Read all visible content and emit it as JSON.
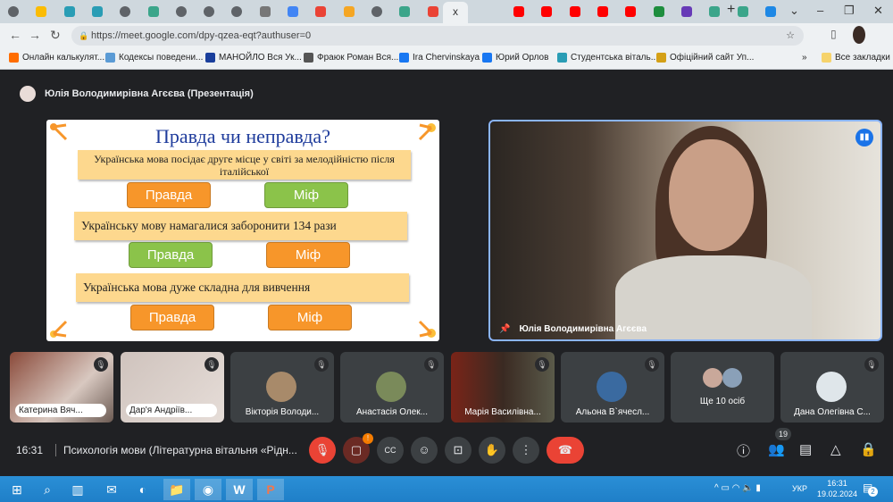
{
  "browser": {
    "tabs": [
      {
        "icon": "globe",
        "color": "#5f6368"
      },
      {
        "icon": "google-drive",
        "color": "#fbbc04"
      },
      {
        "icon": "shield",
        "color": "#2a9db5"
      },
      {
        "icon": "shield",
        "color": "#2a9db5"
      },
      {
        "icon": "globe",
        "color": "#5f6368"
      },
      {
        "icon": "app",
        "color": "#3ba58a"
      },
      {
        "icon": "globe",
        "color": "#5f6368"
      },
      {
        "icon": "globe",
        "color": "#5f6368"
      },
      {
        "icon": "globe",
        "color": "#5f6368"
      },
      {
        "icon": "doc",
        "color": "#777"
      },
      {
        "icon": "google-translate",
        "color": "#4285f4"
      },
      {
        "icon": "google",
        "color": "#ea4335"
      },
      {
        "icon": "warning",
        "color": "#f5a623"
      },
      {
        "icon": "globe",
        "color": "#5f6368"
      },
      {
        "icon": "app",
        "color": "#3ba58a"
      },
      {
        "icon": "gmail",
        "color": "#ea4335"
      },
      {
        "icon": "calendar",
        "color": "#4285f4"
      },
      {
        "icon": "youtube",
        "color": "#ff0000"
      },
      {
        "icon": "youtube",
        "color": "#ff0000"
      },
      {
        "icon": "youtube",
        "color": "#ff0000"
      },
      {
        "icon": "youtube",
        "color": "#ff0000"
      },
      {
        "icon": "youtube",
        "color": "#ff0000"
      },
      {
        "icon": "sheet",
        "color": "#1e8e3e"
      },
      {
        "icon": "forms",
        "color": "#673ab7"
      },
      {
        "icon": "app",
        "color": "#3ba58a"
      },
      {
        "icon": "app",
        "color": "#3ba58a"
      },
      {
        "icon": "p",
        "color": "#1e88e5"
      }
    ],
    "active_tab_close": "x",
    "new_tab": "+",
    "url": "https://meet.google.com/dpy-qzea-eqt?authuser=0",
    "bookmarks": [
      {
        "label": "Онлайн калькулят...",
        "color": "#ff6d00"
      },
      {
        "label": "Кодексы поведени...",
        "color": "#5b9bd5"
      },
      {
        "label": "МАНОЙЛО Вся Ук...",
        "color": "#1a3f9c"
      },
      {
        "label": "Фраюк Роман Вся...",
        "color": "#555"
      },
      {
        "label": "Ira Chervinskaya",
        "color": "#1877f2"
      },
      {
        "label": "Юрий Орлов",
        "color": "#1877f2"
      },
      {
        "label": "Студентська віталь...",
        "color": "#2a9db5"
      },
      {
        "label": "Офіційний сайт Уп...",
        "color": "#d4a017"
      }
    ],
    "more_bookmarks": "»",
    "all_bookmarks": "Все закладки"
  },
  "meet": {
    "presenter_header": "Юлія Володимирівна Агєєва (Презентація)",
    "slide": {
      "title": "Правда чи неправда?",
      "statements": [
        {
          "text": "Українська мова посідає друге місце у світі за мелодійністю після італійської",
          "true_label": "Правда",
          "myth_label": "Міф",
          "highlighted": "myth"
        },
        {
          "text": "Українську мову намагалися заборонити 134 рази",
          "true_label": "Правда",
          "myth_label": "Міф",
          "highlighted": "true"
        },
        {
          "text": "Українська мова дуже складна для вивчення",
          "true_label": "Правда",
          "myth_label": "Міф",
          "highlighted": "none"
        }
      ]
    },
    "main_video_name": "Юлія Володимирівна Агєєва",
    "participants": [
      {
        "name": "Катерина Вяч...",
        "type": "video"
      },
      {
        "name": "Дар'я Андріїв...",
        "type": "video"
      },
      {
        "name": "Вікторія Володи...",
        "type": "avatar"
      },
      {
        "name": "Анастасія Олек...",
        "type": "avatar"
      },
      {
        "name": "Марія Василівна...",
        "type": "video"
      },
      {
        "name": "Альона В`ячесл...",
        "type": "avatar"
      },
      {
        "name": "Ще 10 осіб",
        "type": "more"
      },
      {
        "name": "Дана Олегівна С...",
        "type": "avatar"
      }
    ],
    "time": "16:31",
    "meeting_title": "Психологія мови (Літературна вітальня «Рідн...",
    "participant_count": "19",
    "colors": {
      "end_call": "#ea4335",
      "true_btn": "#f7962a",
      "myth_btn": "#8bc34a"
    }
  },
  "taskbar": {
    "lang": "УКР",
    "time": "16:31",
    "date": "19.02.2024",
    "notifications": "2"
  }
}
